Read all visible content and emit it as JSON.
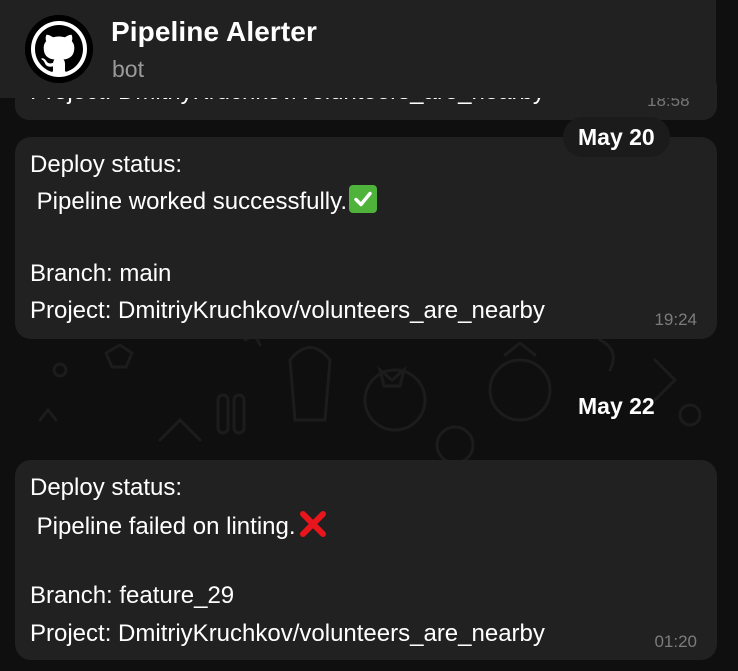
{
  "header": {
    "title": "Pipeline Alerter",
    "subtitle": "bot",
    "avatar_icon": "github-octocat-icon"
  },
  "previous_message": {
    "text": "Project: DmitriyKruchkov/volunteers_are_nearby",
    "time": "18:58"
  },
  "messages": [
    {
      "date": "May 20",
      "heading": "Deploy status:",
      "status": " Pipeline worked successfully.",
      "status_icon": "check-mark-emoji-icon",
      "branch": "Branch: main",
      "project": "Project: DmitriyKruchkov/volunteers_are_nearby",
      "time": "19:24"
    },
    {
      "date": "May 22",
      "heading": "Deploy status:",
      "status": " Pipeline failed on linting.",
      "status_icon": "cross-mark-emoji-icon",
      "branch": "Branch: feature_29",
      "project": "Project: DmitriyKruchkov/volunteers_are_nearby",
      "time": "01:20"
    }
  ],
  "colors": {
    "background": "#0f0f0f",
    "bubble": "#212121",
    "header": "#212121",
    "secondary_text": "#9a9a9a",
    "success": "#4fb23b",
    "error": "#e8161c"
  }
}
